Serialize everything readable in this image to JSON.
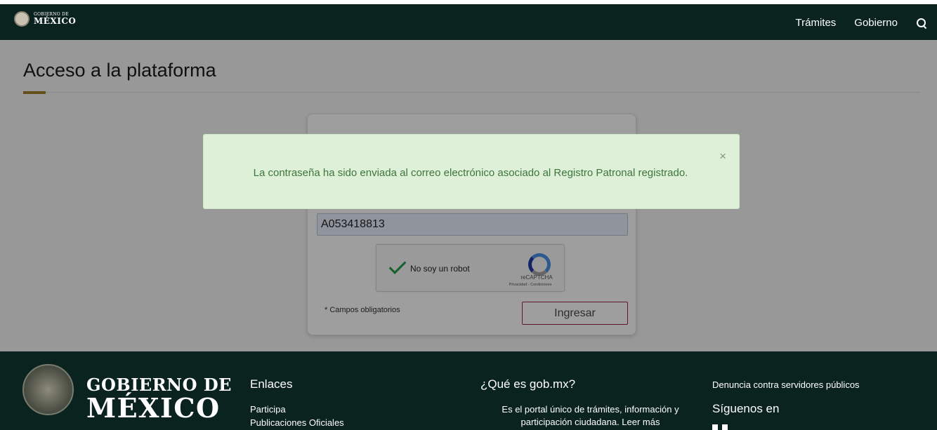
{
  "header": {
    "logo_line1": "GOBIERNO DE",
    "logo_line2": "MÉXICO",
    "nav": [
      "Trámites",
      "Gobierno"
    ]
  },
  "page": {
    "title": "Acceso a la plataforma"
  },
  "login": {
    "registro_value": "A053418813",
    "captcha_label": "No soy un robot",
    "captcha_brand": "reCAPTCHA",
    "captcha_links": "Privacidad - Condiciones",
    "required_note": "* Campos obligatorios",
    "submit_label": "Ingresar"
  },
  "alert": {
    "message": "La contraseña ha sido enviada al correo electrónico asociado al Registro Patronal registrado.",
    "close_symbol": "×"
  },
  "footer": {
    "brand_line1": "GOBIERNO DE",
    "brand_line2": "MÉXICO",
    "links_title": "Enlaces",
    "links": [
      "Participa",
      "Publicaciones Oficiales"
    ],
    "about_title": "¿Qué es gob.mx?",
    "about_text": "Es el portal único de trámites, información y participación ciudadana. Leer más",
    "denuncia": "Denuncia contra servidores públicos",
    "follow_title": "Síguenos en"
  },
  "colors": {
    "header_bg": "#0b231e",
    "accent": "#a57f2c",
    "button_border": "#9d2449",
    "alert_bg": "#dff0d8",
    "alert_text": "#3c763d"
  }
}
